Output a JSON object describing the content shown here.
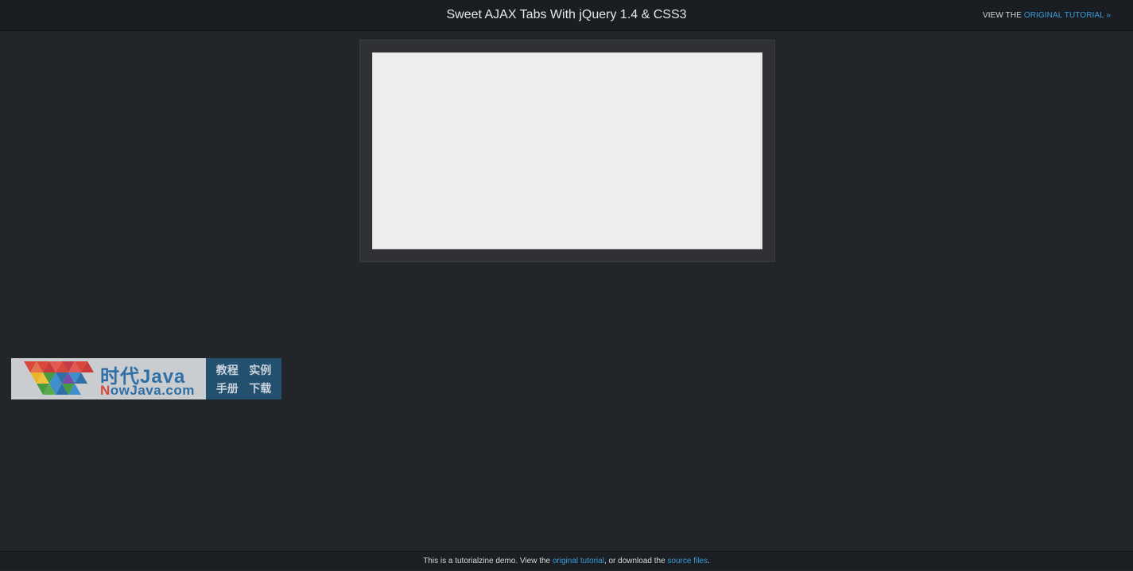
{
  "header": {
    "title": "Sweet AJAX Tabs With jQuery 1.4 & CSS3",
    "view_prefix": "VIEW THE ",
    "view_link": "ORIGINAL TUTORIAL »"
  },
  "banner": {
    "brand_cn": "时代Java",
    "brand_url_n": "N",
    "brand_url_rest": "owJava.com",
    "links": [
      "教程",
      "实例",
      "手册",
      "下载"
    ]
  },
  "footer": {
    "text_1": "This is a tutorialzine demo. View the ",
    "link_1": "original tutorial",
    "text_2": ", or download the ",
    "link_2": "source files",
    "text_3": "."
  },
  "colors": {
    "background": "#22262b",
    "link": "#3a9cd9",
    "content_panel": "#eeeeee"
  }
}
